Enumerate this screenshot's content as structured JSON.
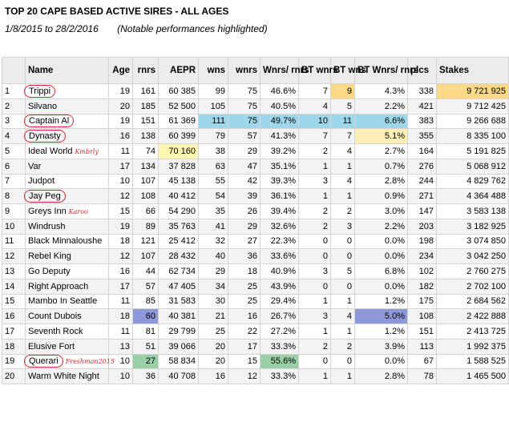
{
  "title": "TOP 20 CAPE BASED ACTIVE SIRES - ALL AGES",
  "period": "1/8/2015 to 28/2/2016",
  "note": "(Notable performances highlighted)",
  "columns": [
    "",
    "Name",
    "Age",
    "rnrs",
    "AEPR",
    "wns",
    "wnrs",
    "Wnrs/ rnrs",
    "BT wnrs",
    "BT wns",
    "BT Wnrs/ rnrs",
    "plcs",
    "Stakes"
  ],
  "rows": [
    {
      "n": "1",
      "name": "Trippi",
      "circled": true,
      "tag": "",
      "age": "19",
      "rnrs": "161",
      "aepr": "60 385",
      "wns": "99",
      "wnrs": "75",
      "pct": "46.6%",
      "btwnrs": "7",
      "btwns": "9",
      "btpct": "4.3%",
      "plcs": "338",
      "stakes": "9 721 925"
    },
    {
      "n": "2",
      "name": "Silvano",
      "circled": false,
      "tag": "",
      "age": "20",
      "rnrs": "185",
      "aepr": "52 500",
      "wns": "105",
      "wnrs": "75",
      "pct": "40.5%",
      "btwnrs": "4",
      "btwns": "5",
      "btpct": "2.2%",
      "plcs": "421",
      "stakes": "9 712 425"
    },
    {
      "n": "3",
      "name": "Captain Al",
      "circled": true,
      "tag": "",
      "age": "19",
      "rnrs": "151",
      "aepr": "61 369",
      "wns": "111",
      "wnrs": "75",
      "pct": "49.7%",
      "btwnrs": "10",
      "btwns": "11",
      "btpct": "6.6%",
      "plcs": "383",
      "stakes": "9 266 688"
    },
    {
      "n": "4",
      "name": "Dynasty",
      "circled": true,
      "tag": "",
      "age": "16",
      "rnrs": "138",
      "aepr": "60 399",
      "wns": "79",
      "wnrs": "57",
      "pct": "41.3%",
      "btwnrs": "7",
      "btwns": "7",
      "btpct": "5.1%",
      "plcs": "355",
      "stakes": "8 335 100"
    },
    {
      "n": "5",
      "name": "Ideal World",
      "circled": false,
      "tag": "Kmbrly",
      "age": "11",
      "rnrs": "74",
      "aepr": "70 160",
      "wns": "38",
      "wnrs": "29",
      "pct": "39.2%",
      "btwnrs": "2",
      "btwns": "4",
      "btpct": "2.7%",
      "plcs": "164",
      "stakes": "5 191 825"
    },
    {
      "n": "6",
      "name": "Var",
      "circled": false,
      "tag": "",
      "age": "17",
      "rnrs": "134",
      "aepr": "37 828",
      "wns": "63",
      "wnrs": "47",
      "pct": "35.1%",
      "btwnrs": "1",
      "btwns": "1",
      "btpct": "0.7%",
      "plcs": "276",
      "stakes": "5 068 912"
    },
    {
      "n": "7",
      "name": "Judpot",
      "circled": false,
      "tag": "",
      "age": "10",
      "rnrs": "107",
      "aepr": "45 138",
      "wns": "55",
      "wnrs": "42",
      "pct": "39.3%",
      "btwnrs": "3",
      "btwns": "4",
      "btpct": "2.8%",
      "plcs": "244",
      "stakes": "4 829 762"
    },
    {
      "n": "8",
      "name": "Jay Peg",
      "circled": true,
      "tag": "",
      "age": "12",
      "rnrs": "108",
      "aepr": "40 412",
      "wns": "54",
      "wnrs": "39",
      "pct": "36.1%",
      "btwnrs": "1",
      "btwns": "1",
      "btpct": "0.9%",
      "plcs": "271",
      "stakes": "4 364 488"
    },
    {
      "n": "9",
      "name": "Greys Inn",
      "circled": false,
      "tag": "Karoo",
      "age": "15",
      "rnrs": "66",
      "aepr": "54 290",
      "wns": "35",
      "wnrs": "26",
      "pct": "39.4%",
      "btwnrs": "2",
      "btwns": "2",
      "btpct": "3.0%",
      "plcs": "147",
      "stakes": "3 583 138"
    },
    {
      "n": "10",
      "name": "Windrush",
      "circled": false,
      "tag": "",
      "age": "19",
      "rnrs": "89",
      "aepr": "35 763",
      "wns": "41",
      "wnrs": "29",
      "pct": "32.6%",
      "btwnrs": "2",
      "btwns": "3",
      "btpct": "2.2%",
      "plcs": "203",
      "stakes": "3 182 925"
    },
    {
      "n": "11",
      "name": "Black Minnaloushe",
      "circled": false,
      "tag": "",
      "age": "18",
      "rnrs": "121",
      "aepr": "25 412",
      "wns": "32",
      "wnrs": "27",
      "pct": "22.3%",
      "btwnrs": "0",
      "btwns": "0",
      "btpct": "0.0%",
      "plcs": "198",
      "stakes": "3 074 850"
    },
    {
      "n": "12",
      "name": "Rebel King",
      "circled": false,
      "tag": "",
      "age": "12",
      "rnrs": "107",
      "aepr": "28 432",
      "wns": "40",
      "wnrs": "36",
      "pct": "33.6%",
      "btwnrs": "0",
      "btwns": "0",
      "btpct": "0.0%",
      "plcs": "234",
      "stakes": "3 042 250"
    },
    {
      "n": "13",
      "name": "Go Deputy",
      "circled": false,
      "tag": "",
      "age": "16",
      "rnrs": "44",
      "aepr": "62 734",
      "wns": "29",
      "wnrs": "18",
      "pct": "40.9%",
      "btwnrs": "3",
      "btwns": "5",
      "btpct": "6.8%",
      "plcs": "102",
      "stakes": "2 760 275"
    },
    {
      "n": "14",
      "name": "Right Approach",
      "circled": false,
      "tag": "",
      "age": "17",
      "rnrs": "57",
      "aepr": "47 405",
      "wns": "34",
      "wnrs": "25",
      "pct": "43.9%",
      "btwnrs": "0",
      "btwns": "0",
      "btpct": "0.0%",
      "plcs": "182",
      "stakes": "2 702 100"
    },
    {
      "n": "15",
      "name": "Mambo In Seattle",
      "circled": false,
      "tag": "",
      "age": "11",
      "rnrs": "85",
      "aepr": "31 583",
      "wns": "30",
      "wnrs": "25",
      "pct": "29.4%",
      "btwnrs": "1",
      "btwns": "1",
      "btpct": "1.2%",
      "plcs": "175",
      "stakes": "2 684 562"
    },
    {
      "n": "16",
      "name": "Count Dubois",
      "circled": false,
      "tag": "",
      "age": "18",
      "rnrs": "60",
      "aepr": "40 381",
      "wns": "21",
      "wnrs": "16",
      "pct": "26.7%",
      "btwnrs": "3",
      "btwns": "4",
      "btpct": "5.0%",
      "plcs": "108",
      "stakes": "2 422 888"
    },
    {
      "n": "17",
      "name": "Seventh Rock",
      "circled": false,
      "tag": "",
      "age": "11",
      "rnrs": "81",
      "aepr": "29 799",
      "wns": "25",
      "wnrs": "22",
      "pct": "27.2%",
      "btwnrs": "1",
      "btwns": "1",
      "btpct": "1.2%",
      "plcs": "151",
      "stakes": "2 413 725"
    },
    {
      "n": "18",
      "name": "Elusive Fort",
      "circled": false,
      "tag": "",
      "age": "13",
      "rnrs": "51",
      "aepr": "39 066",
      "wns": "20",
      "wnrs": "17",
      "pct": "33.3%",
      "btwnrs": "2",
      "btwns": "2",
      "btpct": "3.9%",
      "plcs": "113",
      "stakes": "1 992 375"
    },
    {
      "n": "19",
      "name": "Querari",
      "circled": true,
      "tag": "Freshman2015",
      "age": "10",
      "rnrs": "27",
      "aepr": "58 834",
      "wns": "20",
      "wnrs": "15",
      "pct": "55.6%",
      "btwnrs": "0",
      "btwns": "0",
      "btpct": "0.0%",
      "plcs": "67",
      "stakes": "1 588 525"
    },
    {
      "n": "20",
      "name": "Warm White Night",
      "circled": false,
      "tag": "",
      "age": "10",
      "rnrs": "36",
      "aepr": "40 708",
      "wns": "16",
      "wnrs": "12",
      "pct": "33.3%",
      "btwnrs": "1",
      "btwns": "1",
      "btpct": "2.8%",
      "plcs": "78",
      "stakes": "1 465 500"
    }
  ],
  "highlights": [
    {
      "row": 0,
      "col": "btwns",
      "color": "orange"
    },
    {
      "row": 0,
      "col": "stakes",
      "color": "orange"
    },
    {
      "row": 2,
      "col": "wns",
      "color": "blue"
    },
    {
      "row": 2,
      "col": "wnrs",
      "color": "blue"
    },
    {
      "row": 2,
      "col": "pct",
      "color": "blue"
    },
    {
      "row": 2,
      "col": "btwnrs",
      "color": "blue"
    },
    {
      "row": 2,
      "col": "btwns",
      "color": "blue"
    },
    {
      "row": 2,
      "col": "btpct",
      "color": "blue"
    },
    {
      "row": 3,
      "col": "btpct",
      "color": "lightyellow"
    },
    {
      "row": 4,
      "col": "aepr",
      "color": "yellow"
    },
    {
      "row": 15,
      "col": "rnrs",
      "color": "purple"
    },
    {
      "row": 15,
      "col": "btpct",
      "color": "purple"
    },
    {
      "row": 18,
      "col": "rnrs",
      "color": "green"
    },
    {
      "row": 18,
      "col": "pct",
      "color": "green"
    }
  ],
  "colors": {
    "blue": "#9fd7ea",
    "orange": "#fbd986",
    "yellow": "#fff6b3",
    "lightyellow": "#fdeeb6",
    "purple": "#8e97d7",
    "green": "#9ad0a7",
    "circle": "#d4262c"
  }
}
